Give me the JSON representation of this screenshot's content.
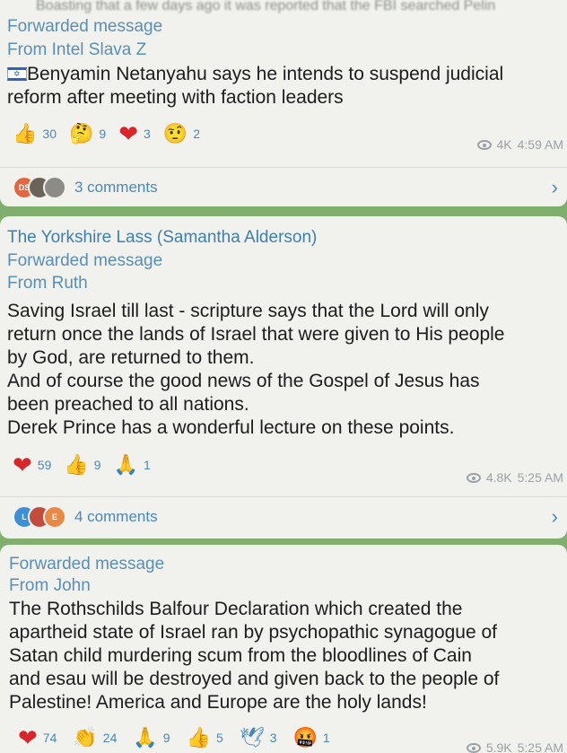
{
  "top_snippet": "Boasting that a few days ago it was reported that the FBI searched Pelin",
  "posts": [
    {
      "forwarded_label": "Forwarded message",
      "from_label": "From Intel Slava Z",
      "text": [
        "Benyamin Netanyahu says he intends to suspend judicial",
        "reform after meeting with faction leaders"
      ],
      "flag_icon": "israel-flag-icon",
      "reactions": [
        {
          "icon": "thumbs-up-icon",
          "glyph": "👍",
          "count": "30"
        },
        {
          "icon": "thinking-face-icon",
          "glyph": "🤔",
          "count": "9"
        },
        {
          "icon": "heart-icon",
          "glyph": "❤",
          "count": "3"
        },
        {
          "icon": "raised-eyebrow-face-icon",
          "glyph": "🤨",
          "count": "2"
        }
      ],
      "views": "4K",
      "time": "4:59 AM",
      "avatars": [
        {
          "initials": "DS",
          "color": "#e0673f"
        },
        {
          "initials": "",
          "color": "#6b6258"
        },
        {
          "initials": "",
          "color": "#8d8b86"
        }
      ],
      "comments": "3 comments"
    },
    {
      "author": "The Yorkshire Lass (Samantha Alderson)",
      "forwarded_label": "Forwarded message",
      "from_label": "From Ruth",
      "text": [
        "Saving Israel till last - scripture says that the Lord will only",
        "return once the lands of Israel that were given to His people",
        "by God, are returned to them.",
        "And of course the good news of the Gospel of Jesus has",
        "been preached to all nations.",
        "Derek Prince has a wonderful lecture on these points."
      ],
      "reactions": [
        {
          "icon": "heart-icon",
          "glyph": "❤",
          "count": "59"
        },
        {
          "icon": "thumbs-up-icon",
          "glyph": "👍",
          "count": "9"
        },
        {
          "icon": "praying-hands-icon",
          "glyph": "🙏",
          "count": "1"
        }
      ],
      "views": "4.8K",
      "time": "5:25 AM",
      "avatars": [
        {
          "initials": "L",
          "color": "#3d8fd6"
        },
        {
          "initials": "",
          "color": "#c24d3c"
        },
        {
          "initials": "E",
          "color": "#e88a45"
        }
      ],
      "comments": "4 comments"
    },
    {
      "forwarded_label": "Forwarded message",
      "from_label": "From John",
      "text": [
        "The Rothschilds Balfour Declaration which created the",
        "apartheid state of Israel ran by psychopathic synagogue of",
        "Satan child murdering scum from the bloodlines of Cain",
        "and esau will be destroyed and given back to the people of",
        "Palestine! America and Europe are the holy lands!"
      ],
      "reactions": [
        {
          "icon": "heart-icon",
          "glyph": "❤",
          "count": "74"
        },
        {
          "icon": "clapping-hands-icon",
          "glyph": "👏",
          "count": "24"
        },
        {
          "icon": "praying-hands-icon",
          "glyph": "🙏",
          "count": "9"
        },
        {
          "icon": "thumbs-up-icon",
          "glyph": "👍",
          "count": "5"
        },
        {
          "icon": "dove-icon",
          "glyph": "🕊",
          "count": "3"
        },
        {
          "icon": "angry-face-icon",
          "glyph": "🤬",
          "count": "1"
        }
      ],
      "views": "5.9K",
      "time": "5:25 AM"
    }
  ],
  "colors": {
    "link": "#4a87b8",
    "forward": "#5b8eb3",
    "background": "#7fae6e",
    "bubble": "#f1f2ee"
  }
}
